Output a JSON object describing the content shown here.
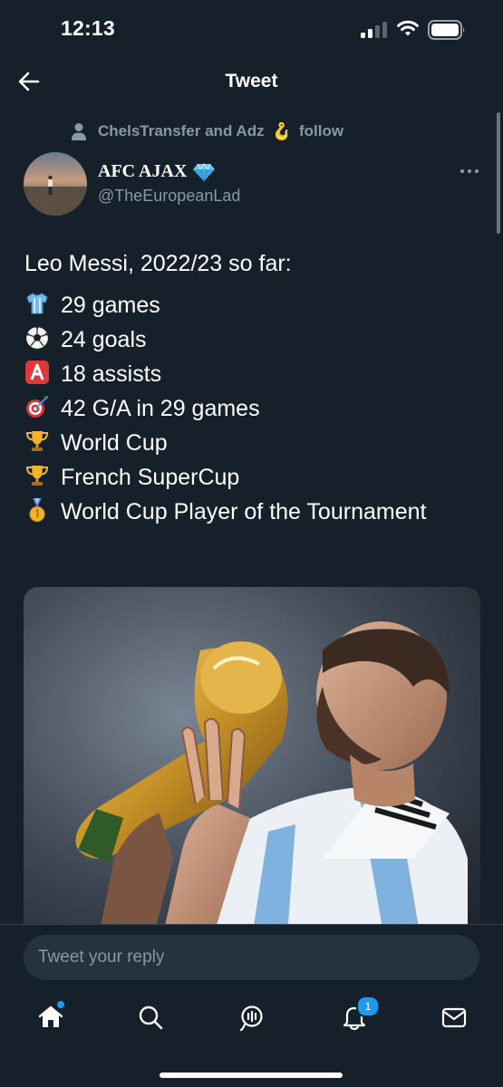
{
  "status_bar": {
    "time": "12:13",
    "icons": [
      "cellular-signal-icon",
      "wifi-icon",
      "battery-icon"
    ]
  },
  "header": {
    "title": "Tweet",
    "back_icon": "arrow-left-icon"
  },
  "social_context": {
    "icon": "person-icon",
    "text_before": "ChelsTransfer and Adz",
    "emoji": "🪝",
    "text_after": "follow"
  },
  "author": {
    "name": "AFC AJAX",
    "badge_icon": "gem-icon",
    "handle": "@TheEuropeanLad"
  },
  "tweet": {
    "intro": "Leo Messi, 2022/23 so far:",
    "lines": [
      {
        "icon": "shirt-icon",
        "text": "29 games"
      },
      {
        "icon": "soccer-ball-icon",
        "text": "24 goals"
      },
      {
        "icon": "letter-a-icon",
        "text": "18 assists"
      },
      {
        "icon": "dart-target-icon",
        "text": "42 G/A in 29 games"
      },
      {
        "icon": "trophy-icon",
        "text": "World Cup"
      },
      {
        "icon": "trophy-icon",
        "text": "French SuperCup"
      },
      {
        "icon": "medal-icon",
        "text": "World Cup Player of the Tournament"
      }
    ]
  },
  "media": {
    "subject": "player-kissing-trophy-photo"
  },
  "reply": {
    "placeholder": "Tweet your reply"
  },
  "tabbar": {
    "items": [
      {
        "icon": "home-icon",
        "has_dot": true
      },
      {
        "icon": "search-icon"
      },
      {
        "icon": "spaces-icon"
      },
      {
        "icon": "bell-icon",
        "badge": "1"
      },
      {
        "icon": "mail-icon"
      }
    ]
  },
  "colors": {
    "background": "#15202b",
    "secondary_text": "#8899a6",
    "accent": "#1d9bf0",
    "input_background": "#253341"
  }
}
